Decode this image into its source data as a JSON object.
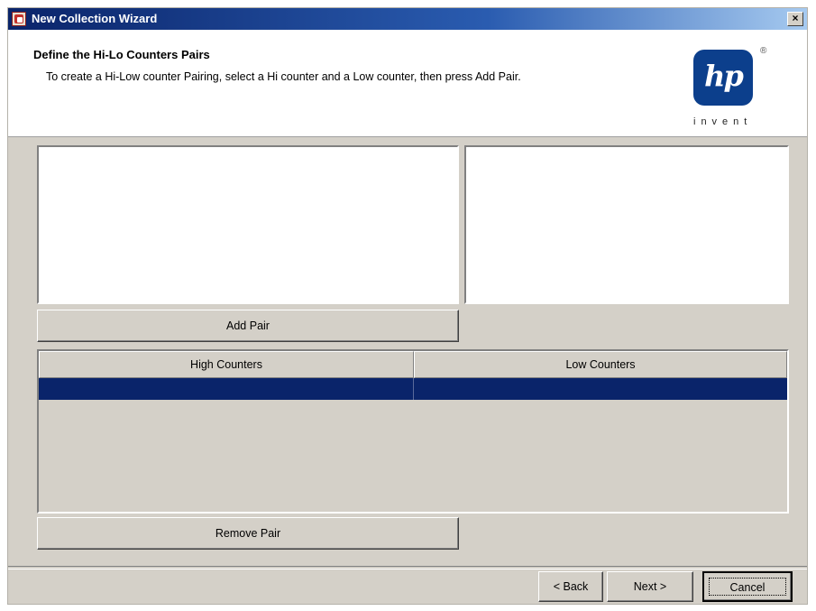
{
  "window": {
    "title": "New Collection Wizard",
    "close_label": "×"
  },
  "header": {
    "title": "Define the Hi-Lo Counters Pairs",
    "description": "To create a Hi-Low counter Pairing, select a Hi counter and a Low counter, then press Add Pair.",
    "logo_text": "hp",
    "logo_registered": "®",
    "logo_tagline": "invent"
  },
  "lists": {
    "high_items": [],
    "low_items": []
  },
  "buttons": {
    "add_pair": "Add Pair",
    "remove_pair": "Remove Pair",
    "back": "< Back",
    "next": "Next >",
    "cancel": "Cancel"
  },
  "table": {
    "columns": [
      "High Counters",
      "Low Counters"
    ],
    "rows": [
      {
        "high": "",
        "low": "",
        "selected": true
      }
    ]
  },
  "colors": {
    "selection": "#0a246a",
    "logo": "#0c3f8c",
    "window_bg": "#d4d0c8"
  }
}
